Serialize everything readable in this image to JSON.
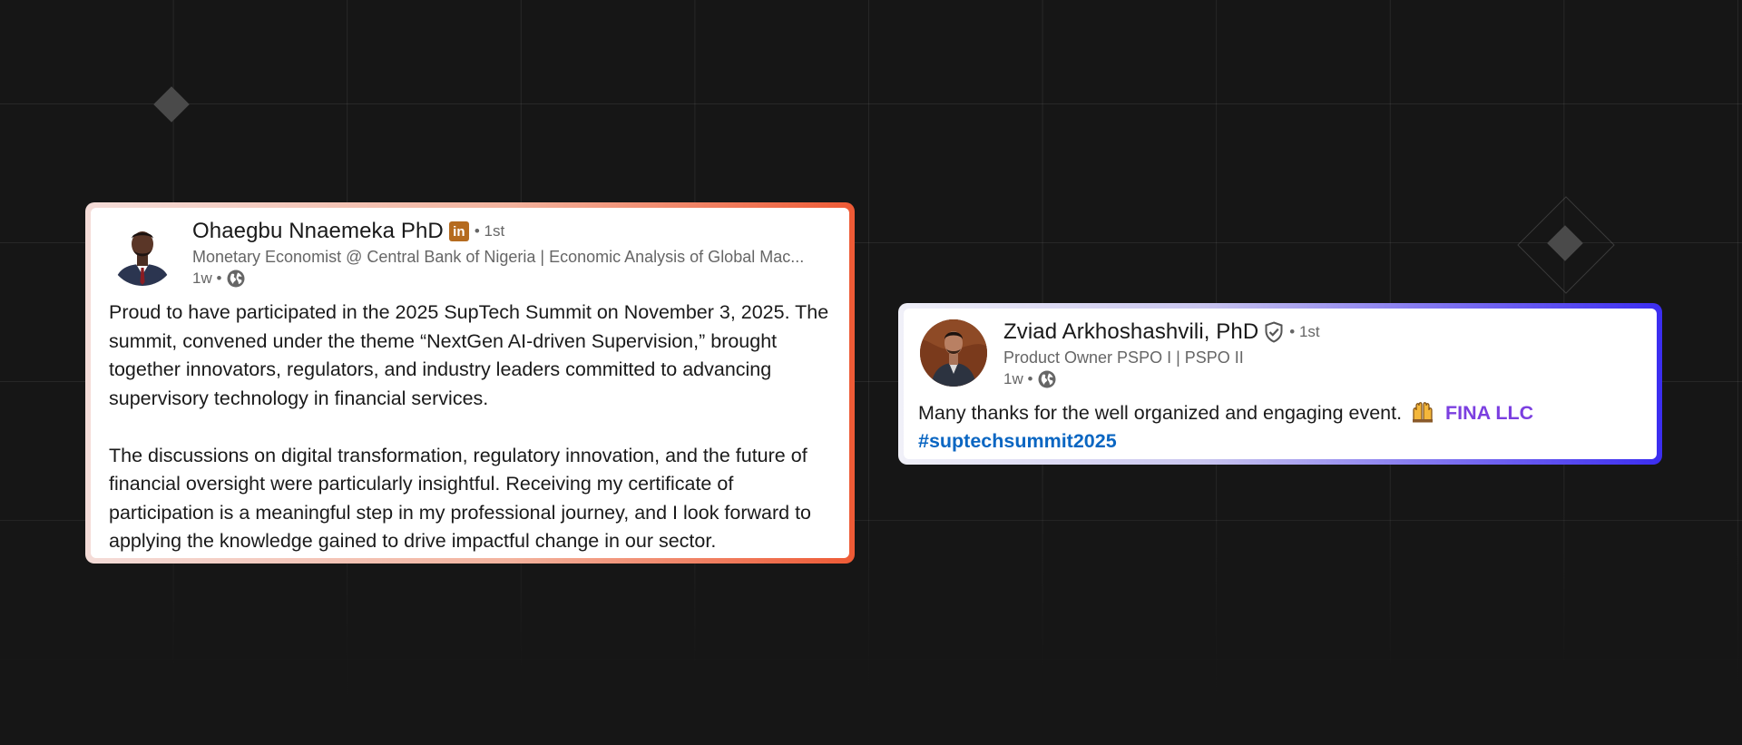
{
  "colors": {
    "background": "#161616",
    "frame_orange": "#ee5a35",
    "frame_blue": "#3b2df0",
    "mention": "#7b3fe0",
    "hashtag": "#0a66c2"
  },
  "posts": [
    {
      "author_name": "Ohaegbu Nnaemeka PhD",
      "badge_icon": "linkedin-icon",
      "badge_text": "in",
      "degree": "• 1st",
      "headline": "Monetary Economist @ Central Bank of Nigeria | Economic Analysis of Global Mac...",
      "time": "1w •",
      "visibility_icon": "globe-icon",
      "paragraphs": [
        "Proud to have participated in the 2025 SupTech Summit on November 3, 2025. The summit, convened under the theme “NextGen AI-driven Supervision,” brought together innovators, regulators, and industry leaders committed to advancing supervisory technology in financial services.",
        "The discussions on digital transformation, regulatory innovation, and the future of financial oversight were particularly insightful. Receiving my certificate of participation is a meaningful step in my professional journey, and I look forward to applying the knowledge gained to drive impactful change in our sector."
      ]
    },
    {
      "author_name": "Zviad Arkhoshashvili, PhD",
      "badge_icon": "verified-shield-icon",
      "degree": "• 1st",
      "headline": "Product Owner PSPO I | PSPO II",
      "time": "1w •",
      "visibility_icon": "globe-icon",
      "text": "Many thanks for the well organized and engaging event.",
      "emoji_icon": "raising-hands-emoji-icon",
      "mention": "FINA LLC",
      "hashtag": "#suptechsummit2025"
    }
  ]
}
